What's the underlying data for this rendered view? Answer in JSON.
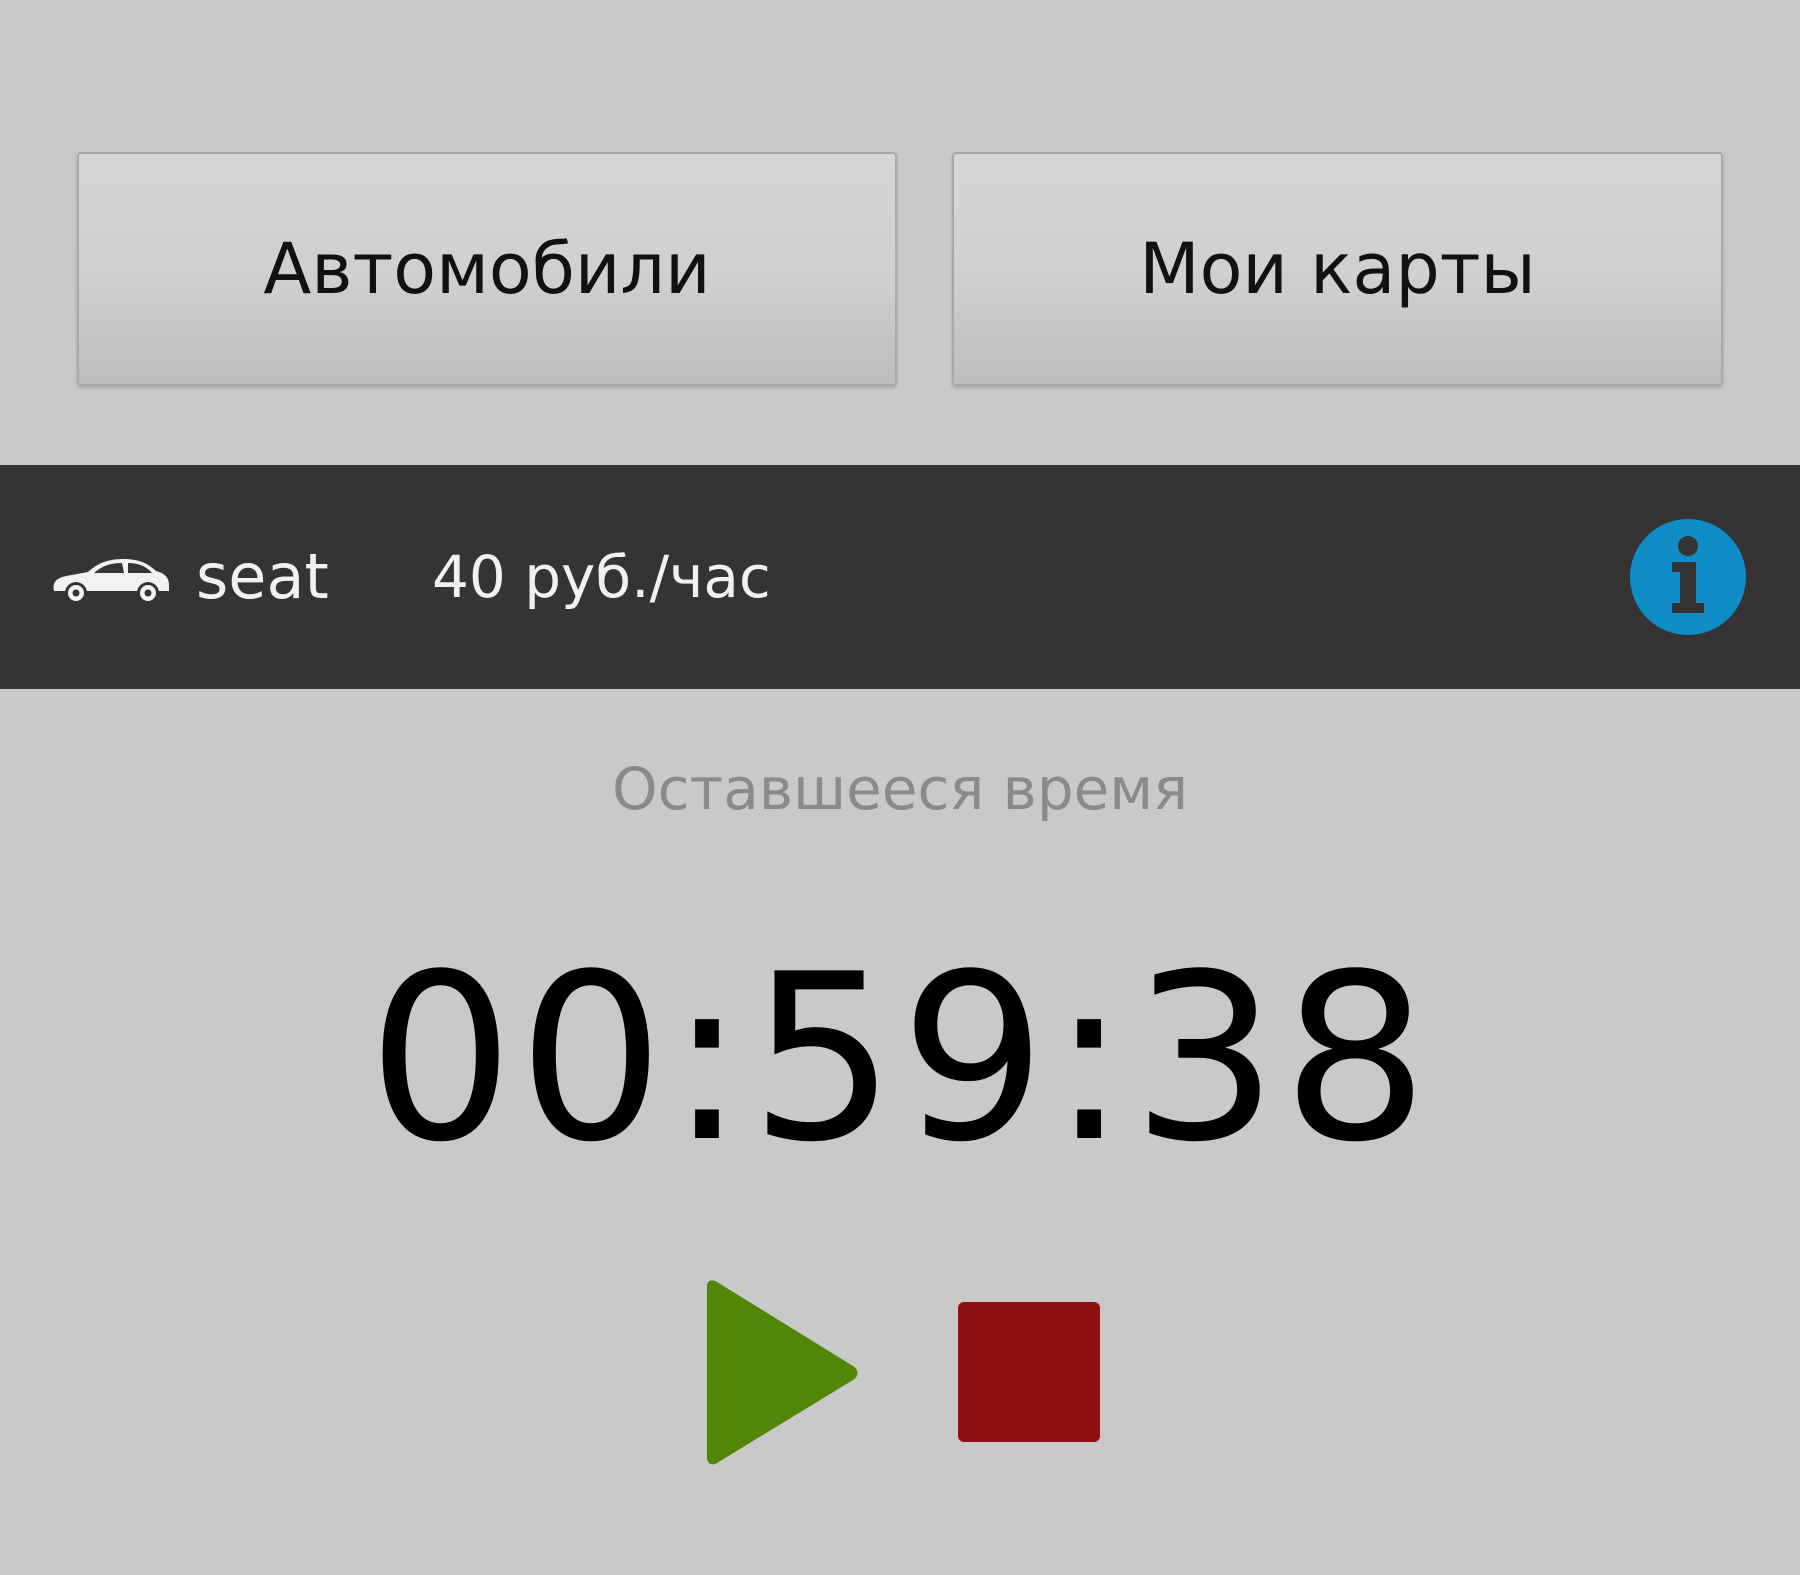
{
  "nav": {
    "cars_label": "Автомобили",
    "cards_label": "Мои карты"
  },
  "car_bar": {
    "icon": "car-icon",
    "car_name": "seat",
    "rate": "40 руб./час",
    "info_icon": "info-icon",
    "info_color": "#0f8cc6"
  },
  "timer": {
    "label": "Оставшееся время",
    "value": "00:59:38"
  },
  "controls": {
    "play_icon": "play-icon",
    "play_color": "#528608",
    "stop_icon": "stop-icon",
    "stop_color": "#8f0e0f"
  }
}
